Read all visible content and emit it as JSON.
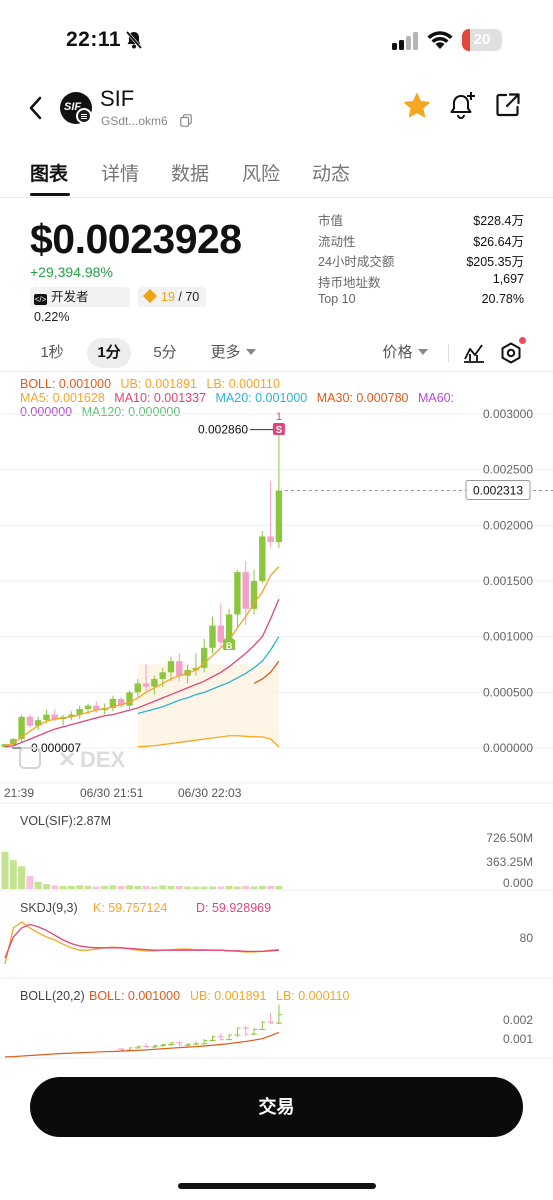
{
  "status_bar": {
    "time": "22:11",
    "battery": "20",
    "battery_level": 0.2
  },
  "header": {
    "symbol": "SIF",
    "address": "GSdt...okm6"
  },
  "tabs": [
    {
      "label": "图表",
      "active": true
    },
    {
      "label": "详情"
    },
    {
      "label": "数据"
    },
    {
      "label": "风险"
    },
    {
      "label": "动态"
    }
  ],
  "price": {
    "value": "$0.0023928",
    "change": "+29,394.98%",
    "dev_label": "开发者 0.22%",
    "holders_hl": "19",
    "holders_total": "/ 70"
  },
  "stats": [
    {
      "label": "市值",
      "value": "$228.4万"
    },
    {
      "label": "流动性",
      "value": "$26.64万"
    },
    {
      "label": "24小时成交额",
      "value": "$205.35万"
    },
    {
      "label": "持币地址数",
      "value": "1,697"
    },
    {
      "label": "Top 10",
      "value": "20.78%"
    }
  ],
  "timeframes": {
    "tf1": "1秒",
    "tf2": "1分",
    "tf3": "5分",
    "more": "更多",
    "price_type": "价格"
  },
  "legend": {
    "boll": "BOLL: 0.001000",
    "ub": "UB: 0.001891",
    "lb": "LB: 0.000110",
    "ma5": "MA5: 0.001628",
    "ma10": "MA10: 0.001337",
    "ma20": "MA20: 0.001000",
    "ma30": "MA30: 0.000780",
    "ma60": "MA60:",
    "ma60_val": "0.000000",
    "ma120": "MA120: 0.000000"
  },
  "main_chart": {
    "y_ticks": [
      "0.003000",
      "0.002500",
      "0.002000",
      "0.001500",
      "0.001000",
      "0.000500",
      "0.000000"
    ],
    "high_label": "0.002860",
    "low_label": "0.000007",
    "current_label": "0.002313",
    "sell_marker": "S",
    "sell_count": "1",
    "buy_marker": "B",
    "watermark": "DEX",
    "x_labels": [
      "21:39",
      "06/30 21:51",
      "06/30 22:03"
    ]
  },
  "volume": {
    "title": "VOL(SIF):2.87M",
    "ticks": [
      "726.50M",
      "363.25M",
      "0.000"
    ]
  },
  "skdj": {
    "title": "SKDJ(9,3)",
    "k": "K: 59.757124",
    "d": "D: 59.928969",
    "tick": "80"
  },
  "boll_panel": {
    "title": "BOLL(20,2)",
    "boll": "BOLL: 0.001000",
    "ub": "UB: 0.001891",
    "lb": "LB: 0.000110",
    "ticks": [
      "0.002",
      "0.001"
    ]
  },
  "trade_button": "交易",
  "colors": {
    "up": "#8cc63f",
    "down": "#f4a0c8",
    "ma5": "#f5a623",
    "ma10": "#e0457b",
    "ma20": "#2bb3d6",
    "ma30": "#e05a1b",
    "ma60": "#b44ad6",
    "ma120": "#5bc276",
    "accent_star": "#f5a623",
    "positive": "#27a046"
  },
  "chart_data": {
    "type": "candlestick",
    "candles": [
      {
        "o": 7e-06,
        "h": 4e-05,
        "l": 7e-06,
        "c": 3.5e-05
      },
      {
        "o": 3e-05,
        "h": 9e-05,
        "l": 2e-05,
        "c": 8e-05
      },
      {
        "o": 8e-05,
        "h": 0.0003,
        "l": 5e-05,
        "c": 0.00028
      },
      {
        "o": 0.00028,
        "h": 0.0003,
        "l": 0.00018,
        "c": 0.0002
      },
      {
        "o": 0.0002,
        "h": 0.00028,
        "l": 0.00016,
        "c": 0.00025
      },
      {
        "o": 0.00025,
        "h": 0.00034,
        "l": 0.00022,
        "c": 0.0003
      },
      {
        "o": 0.0003,
        "h": 0.00035,
        "l": 0.00024,
        "c": 0.00026
      },
      {
        "o": 0.00026,
        "h": 0.0003,
        "l": 0.0002,
        "c": 0.00028
      },
      {
        "o": 0.00028,
        "h": 0.00033,
        "l": 0.00025,
        "c": 0.0003
      },
      {
        "o": 0.0003,
        "h": 0.00038,
        "l": 0.00026,
        "c": 0.00035
      },
      {
        "o": 0.00035,
        "h": 0.0004,
        "l": 0.0003,
        "c": 0.00038
      },
      {
        "o": 0.00038,
        "h": 0.00042,
        "l": 0.00032,
        "c": 0.00034
      },
      {
        "o": 0.00034,
        "h": 0.0004,
        "l": 0.0003,
        "c": 0.00036
      },
      {
        "o": 0.00036,
        "h": 0.00047,
        "l": 0.00033,
        "c": 0.00044
      },
      {
        "o": 0.00044,
        "h": 0.00046,
        "l": 0.00036,
        "c": 0.00038
      },
      {
        "o": 0.00038,
        "h": 0.00052,
        "l": 0.00035,
        "c": 0.0005
      },
      {
        "o": 0.0005,
        "h": 0.00062,
        "l": 0.00045,
        "c": 0.00058
      },
      {
        "o": 0.00058,
        "h": 0.00075,
        "l": 0.0005,
        "c": 0.00055
      },
      {
        "o": 0.00055,
        "h": 0.00065,
        "l": 0.00048,
        "c": 0.00062
      },
      {
        "o": 0.00062,
        "h": 0.00072,
        "l": 0.00055,
        "c": 0.00068
      },
      {
        "o": 0.00068,
        "h": 0.00082,
        "l": 0.0006,
        "c": 0.00078
      },
      {
        "o": 0.00078,
        "h": 0.00085,
        "l": 0.0006,
        "c": 0.00065
      },
      {
        "o": 0.00065,
        "h": 0.00075,
        "l": 0.00058,
        "c": 0.0007
      },
      {
        "o": 0.0007,
        "h": 0.00085,
        "l": 0.00065,
        "c": 0.00072
      },
      {
        "o": 0.00072,
        "h": 0.00098,
        "l": 0.00068,
        "c": 0.0009
      },
      {
        "o": 0.0009,
        "h": 0.00118,
        "l": 0.00085,
        "c": 0.0011
      },
      {
        "o": 0.0011,
        "h": 0.0013,
        "l": 0.0009,
        "c": 0.00095
      },
      {
        "o": 0.00095,
        "h": 0.00125,
        "l": 0.0009,
        "c": 0.0012
      },
      {
        "o": 0.0012,
        "h": 0.0016,
        "l": 0.00108,
        "c": 0.00158
      },
      {
        "o": 0.00158,
        "h": 0.00168,
        "l": 0.0011,
        "c": 0.00125
      },
      {
        "o": 0.00125,
        "h": 0.0016,
        "l": 0.0012,
        "c": 0.0015
      },
      {
        "o": 0.0015,
        "h": 0.00195,
        "l": 0.00148,
        "c": 0.0019
      },
      {
        "o": 0.0019,
        "h": 0.0024,
        "l": 0.0018,
        "c": 0.00185
      },
      {
        "o": 0.00185,
        "h": 0.00286,
        "l": 0.0018,
        "c": 0.002313
      }
    ],
    "ylim": [
      0,
      0.003
    ],
    "ma5": [
      2e-05,
      4e-05,
      0.0001,
      0.00015,
      0.0002,
      0.00024,
      0.00026,
      0.00027,
      0.00028,
      0.0003,
      0.00032,
      0.00034,
      0.00035,
      0.00037,
      0.00039,
      0.00041,
      0.00045,
      0.0005,
      0.00054,
      0.00058,
      0.00062,
      0.00065,
      0.00067,
      0.0007,
      0.00076,
      0.00083,
      0.0009,
      0.00097,
      0.00108,
      0.00118,
      0.0013,
      0.0014,
      0.00155,
      0.001628
    ],
    "ma10": [
      1e-05,
      2e-05,
      5e-05,
      8e-05,
      0.00011,
      0.00014,
      0.00017,
      0.00019,
      0.00021,
      0.00023,
      0.00025,
      0.00027,
      0.00029,
      0.0003,
      0.00032,
      0.00034,
      0.00036,
      0.00039,
      0.00042,
      0.00045,
      0.00048,
      0.00051,
      0.00054,
      0.00057,
      0.0006,
      0.00064,
      0.00068,
      0.00073,
      0.00079,
      0.00085,
      0.00092,
      0.001,
      0.00116,
      0.001337
    ],
    "ma20": [
      null,
      null,
      null,
      null,
      null,
      null,
      null,
      null,
      null,
      null,
      null,
      null,
      null,
      null,
      null,
      null,
      0.00031,
      0.00033,
      0.00035,
      0.00037,
      0.0004,
      0.00043,
      0.00045,
      0.00048,
      0.0005,
      0.00053,
      0.00056,
      0.00059,
      0.00063,
      0.00067,
      0.00072,
      0.00078,
      0.00088,
      0.001
    ],
    "ma30": [
      null,
      null,
      null,
      null,
      null,
      null,
      null,
      null,
      null,
      null,
      null,
      null,
      null,
      null,
      null,
      null,
      null,
      null,
      null,
      null,
      null,
      null,
      null,
      null,
      null,
      null,
      null,
      null,
      null,
      null,
      0.00058,
      0.00062,
      0.00068,
      0.00078
    ],
    "boll_lb": [
      null,
      null,
      null,
      null,
      null,
      null,
      null,
      null,
      null,
      null,
      null,
      null,
      null,
      null,
      null,
      null,
      1.2e-05,
      1.5e-05,
      2e-05,
      3e-05,
      4e-05,
      5e-05,
      6e-05,
      7e-05,
      8e-05,
      9e-05,
      0.0001,
      0.00011,
      0.00011,
      0.000105,
      0.0001,
      0.0001,
      8e-05,
      1e-05
    ],
    "volume_max": 726500000,
    "volume_rel": [
      0.62,
      0.48,
      0.38,
      0.22,
      0.12,
      0.08,
      0.06,
      0.05,
      0.05,
      0.06,
      0.05,
      0.04,
      0.05,
      0.06,
      0.05,
      0.06,
      0.05,
      0.05,
      0.04,
      0.06,
      0.05,
      0.05,
      0.04,
      0.04,
      0.04,
      0.04,
      0.04,
      0.05,
      0.04,
      0.05,
      0.04,
      0.05,
      0.05,
      0.05
    ],
    "skdj_k": [
      10,
      70,
      80,
      70,
      62,
      55,
      50,
      43,
      37,
      33,
      33,
      35,
      37,
      38,
      37,
      35,
      33,
      32,
      32,
      33,
      34,
      35,
      35,
      34,
      34,
      33,
      33,
      32,
      31,
      30,
      30,
      31,
      33,
      34
    ],
    "skdj_d": [
      20,
      55,
      70,
      76,
      72,
      66,
      58,
      50,
      44,
      40,
      38,
      37,
      37,
      37,
      37,
      36,
      35,
      34,
      33,
      33,
      33,
      33,
      33,
      33,
      33,
      33,
      33,
      32,
      32,
      31,
      31,
      31,
      32,
      33
    ]
  }
}
